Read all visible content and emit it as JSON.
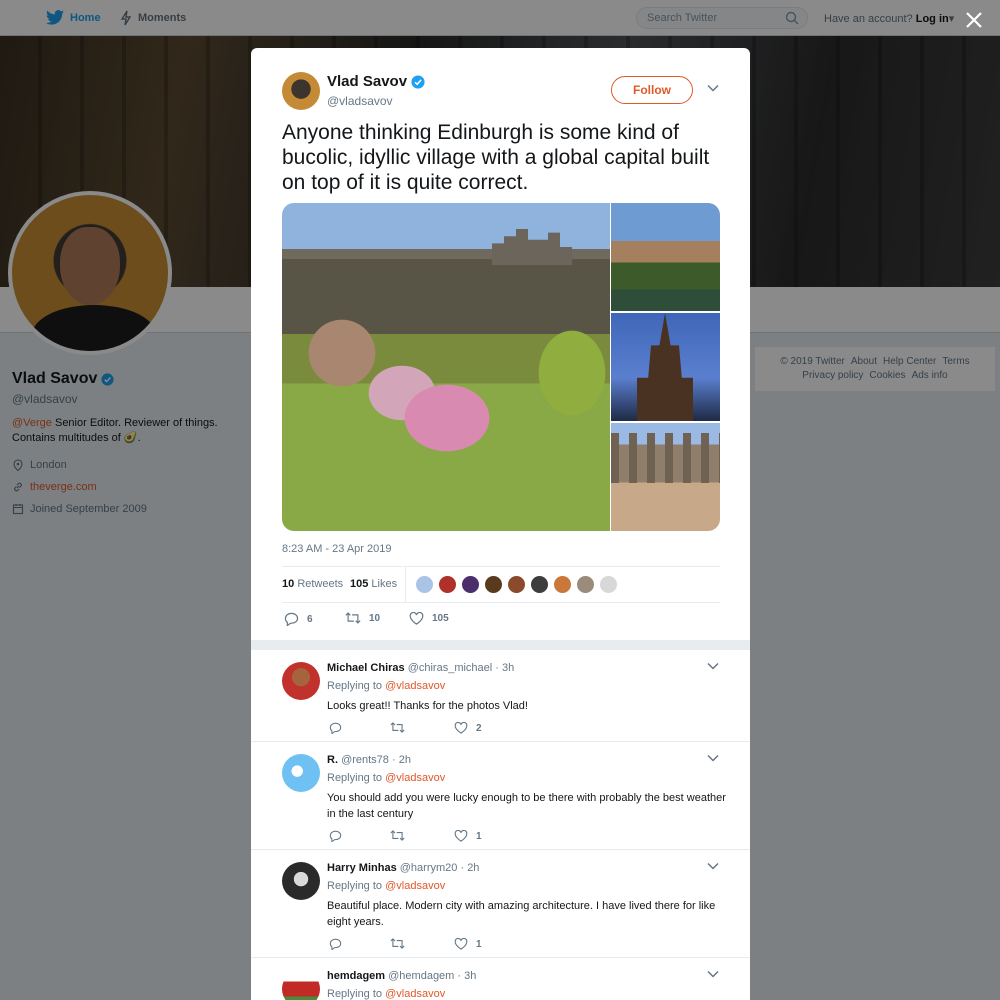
{
  "topbar": {
    "home_label": "Home",
    "moments_label": "Moments",
    "search_placeholder": "Search Twitter",
    "have_account": "Have an account?",
    "login_label": "Log in"
  },
  "profile": {
    "name": "Vlad Savov",
    "handle": "@vladsavov",
    "bio_mention": "@Verge",
    "bio_line1": " Senior Editor. Reviewer of things.",
    "bio_line2": "Contains multitudes of 🥑.",
    "location": "London",
    "website": "theverge.com",
    "joined": "Joined September 2009"
  },
  "footer": {
    "links_row1": [
      "© 2019 Twitter",
      "About",
      "Help Center",
      "Terms"
    ],
    "links_row2": [
      "Privacy policy",
      "Cookies",
      "Ads info"
    ]
  },
  "tweet": {
    "author_name": "Vlad Savov",
    "author_handle": "@vladsavov",
    "follow_label": "Follow",
    "text": "Anyone thinking Edinburgh is some kind of bucolic, idyllic village with a global capital built on top of it is quite correct.",
    "timestamp": "8:23 AM - 23 Apr 2019",
    "retweets_count": "10",
    "retweets_label": "Retweets",
    "likes_count": "105",
    "likes_label": "Likes",
    "reply_count": "6",
    "retweet_action_count": "10",
    "like_action_count": "105"
  },
  "replies": [
    {
      "name": "Michael Chiras",
      "handle": "@chiras_michael",
      "time": "· 3h",
      "replying_prefix": "Replying to",
      "replying_to": "@vladsavov",
      "text": "Looks great!! Thanks for the photos Vlad!",
      "likes": "2",
      "retweets": ""
    },
    {
      "name": "R.",
      "handle": "@rents78",
      "time": "· 2h",
      "replying_prefix": "Replying to",
      "replying_to": "@vladsavov",
      "text": "You should add you were lucky enough to be there with probably the best weather in the last century",
      "likes": "1",
      "retweets": ""
    },
    {
      "name": "Harry Minhas",
      "handle": "@harrym20",
      "time": "· 2h",
      "replying_prefix": "Replying to",
      "replying_to": "@vladsavov",
      "text": "Beautiful place. Modern city with amazing architecture. I have lived there for like eight years.",
      "likes": "1",
      "retweets": ""
    },
    {
      "name": "hemdagem",
      "handle": "@hemdagem",
      "time": "· 3h",
      "replying_prefix": "Replying to",
      "replying_to": "@vladsavov"
    }
  ],
  "colors": {
    "brand_blue": "#1da1f2",
    "accent_orange": "#e0592a",
    "verified_blue": "#1da1f2"
  }
}
